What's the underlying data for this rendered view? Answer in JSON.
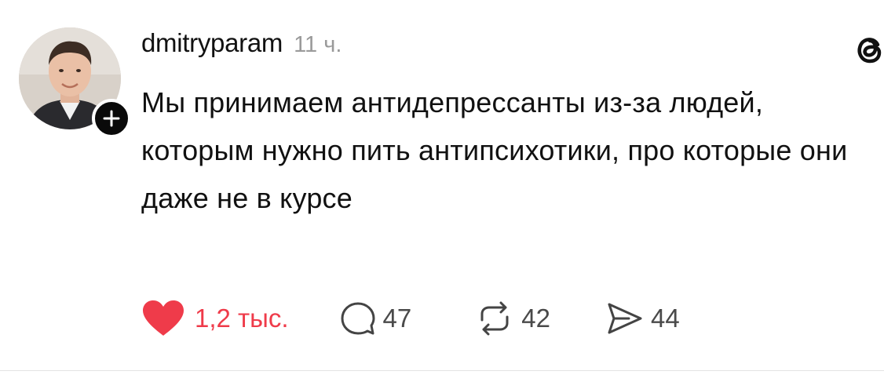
{
  "post": {
    "author": {
      "username": "dmitryparam",
      "avatar_icon": "user-avatar-photo"
    },
    "timestamp": "11 ч.",
    "text": "Мы принимаем антидепрессанты из-за людей, которым нужно пить антипсихотики, про которые они даже не в курсе",
    "app_logo_icon": "threads-logo-icon",
    "actions": {
      "like": {
        "icon": "heart-icon",
        "count": "1,2 тыс.",
        "liked": true,
        "color": "#ef3b4a"
      },
      "reply": {
        "icon": "comment-icon",
        "count": "47"
      },
      "repost": {
        "icon": "repost-icon",
        "count": "42"
      },
      "share": {
        "icon": "share-icon",
        "count": "44"
      }
    },
    "follow_icon": "plus-icon"
  }
}
